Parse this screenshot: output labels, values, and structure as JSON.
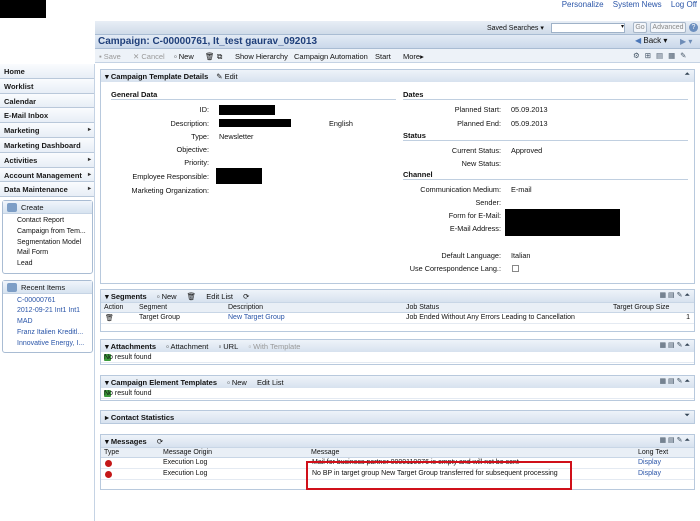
{
  "top_links": [
    "Personalize",
    "System News",
    "Log Off"
  ],
  "saved_searches": {
    "label": "Saved Searches",
    "go": "Go",
    "advanced": "Advanced"
  },
  "title": {
    "text": "Campaign: C-00000761, It_test gaurav_092013",
    "back": "Back"
  },
  "toolbar": {
    "save": "Save",
    "cancel": "Cancel",
    "new": "New",
    "hierarchy": "Show Hierarchy",
    "automation": "Campaign Automation",
    "start": "Start",
    "more": "More"
  },
  "nav": {
    "items": [
      "Home",
      "Worklist",
      "Calendar",
      "E-Mail Inbox",
      "Marketing",
      "Marketing Dashboard",
      "Activities",
      "Account Management",
      "Data Maintenance"
    ],
    "create": {
      "title": "Create",
      "items": [
        "Contact Report",
        "Campaign from Tem...",
        "Segmentation Model",
        "Mail Form",
        "Lead"
      ]
    },
    "recent": {
      "title": "Recent Items",
      "items": [
        "C-00000761",
        "2012-09-21 Int1 Int1",
        "MAD",
        "Franz Italien Kreditl...",
        "Innovative Energy, I..."
      ]
    }
  },
  "details": {
    "title": "Campaign Template Details",
    "edit": "Edit",
    "general": {
      "title": "General Data",
      "labels": {
        "id": "ID:",
        "description": "Description:",
        "type": "Type:",
        "objective": "Objective:",
        "priority": "Priority:",
        "employee": "Employee Responsible:",
        "org": "Marketing Organization:"
      },
      "language": "English",
      "type": "Newsletter"
    },
    "dates": {
      "title": "Dates",
      "planned_start_label": "Planned Start:",
      "planned_start": "05.09.2013",
      "planned_end_label": "Planned End:",
      "planned_end": "05.09.2013"
    },
    "status": {
      "title": "Status",
      "current_label": "Current Status:",
      "current": "Approved",
      "new_label": "New Status:"
    },
    "channel": {
      "title": "Channel",
      "medium_label": "Communication Medium:",
      "medium": "E-mail",
      "sender_label": "Sender:",
      "form_label": "Form for E-Mail:",
      "email_label": "E-Mail Address:",
      "lang_label": "Default Language:",
      "lang": "Italian",
      "corr_label": "Use Correspondence Lang.:"
    }
  },
  "segments": {
    "title": "Segments",
    "new": "New",
    "edit": "Edit List",
    "columns": [
      "Action",
      "Segment",
      "Description",
      "Job Status",
      "Target Group Size"
    ],
    "row": {
      "segment": "Target Group",
      "description": "New Target Group",
      "job": "Job Ended Without Any Errors Leading to Cancellation",
      "size": "1"
    }
  },
  "attachments": {
    "title": "Attachments",
    "attachment": "Attachment",
    "url": "URL",
    "template": "With Template",
    "empty": "No result found"
  },
  "elements": {
    "title": "Campaign Element Templates",
    "new": "New",
    "edit": "Edit List",
    "empty": "No result found"
  },
  "contact_stats": {
    "title": "Contact Statistics"
  },
  "messages": {
    "title": "Messages",
    "columns": [
      "Type",
      "Message Origin",
      "Message",
      "Long Text"
    ],
    "rows": [
      {
        "origin": "Execution Log",
        "message": "Mail for business partner 0000110076 is empty and will not be sent",
        "long": "Display"
      },
      {
        "origin": "Execution Log",
        "message": "No BP in target group New Target Group transferred for subsequent processing",
        "long": "Display"
      }
    ]
  },
  "colors": {
    "highlight": "#d0101a",
    "link": "#2a55a8"
  }
}
